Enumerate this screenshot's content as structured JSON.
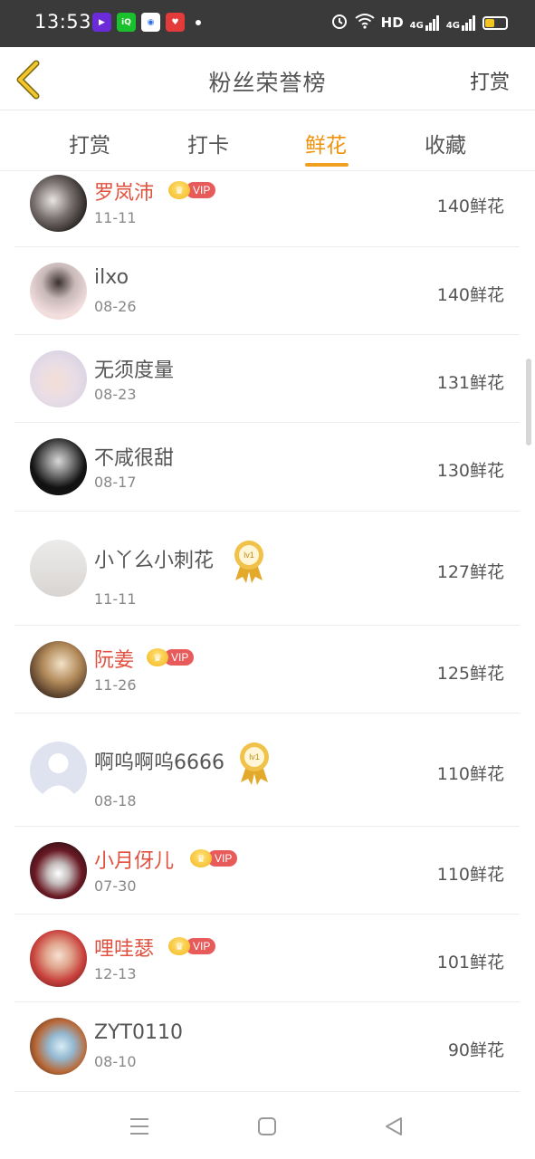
{
  "status_bar": {
    "time": "13:53",
    "network_label": "HD",
    "signal_label_1": "4G",
    "signal_label_2": "4G",
    "app_icons": [
      "video-app-icon",
      "iqiyi-icon",
      "browser-icon",
      "heart-app-icon"
    ]
  },
  "header": {
    "title": "粉丝荣誉榜",
    "action_label": "打赏"
  },
  "tabs": [
    {
      "label": "打赏",
      "active": false
    },
    {
      "label": "打卡",
      "active": false
    },
    {
      "label": "鲜花",
      "active": true
    },
    {
      "label": "收藏",
      "active": false
    }
  ],
  "colors": {
    "accent": "#f0920b",
    "vip_name": "#e0513f",
    "vip_badge": "#e85b5b"
  },
  "list": {
    "rows": [
      {
        "name": "罗岚沛",
        "date": "11-11",
        "amount": "140鲜花",
        "badge": "vip",
        "vip_label": "VIP"
      },
      {
        "name": "ilxo",
        "date": "08-26",
        "amount": "140鲜花",
        "badge": "none"
      },
      {
        "name": "无须度量",
        "date": "08-23",
        "amount": "131鲜花",
        "badge": "none"
      },
      {
        "name": "不咸很甜",
        "date": "08-17",
        "amount": "130鲜花",
        "badge": "none"
      },
      {
        "name": "小丫么小刺花",
        "date": "11-11",
        "amount": "127鲜花",
        "badge": "medal",
        "medal_label": "lv1"
      },
      {
        "name": "阮姜",
        "date": "11-26",
        "amount": "125鲜花",
        "badge": "vip",
        "vip_label": "VIP"
      },
      {
        "name": "啊呜啊呜6666",
        "date": "08-18",
        "amount": "110鲜花",
        "badge": "medal",
        "medal_label": "lv1"
      },
      {
        "name": "小月伢儿",
        "date": "07-30",
        "amount": "110鲜花",
        "badge": "vip",
        "vip_label": "VIP"
      },
      {
        "name": "哩哇瑟",
        "date": "12-13",
        "amount": "101鲜花",
        "badge": "vip",
        "vip_label": "VIP"
      },
      {
        "name": "ZYT0110",
        "date": "08-10",
        "amount": "90鲜花",
        "badge": "none"
      }
    ]
  },
  "nav_bar": {
    "icons": [
      "menu-icon",
      "home-square-icon",
      "back-triangle-icon"
    ]
  }
}
